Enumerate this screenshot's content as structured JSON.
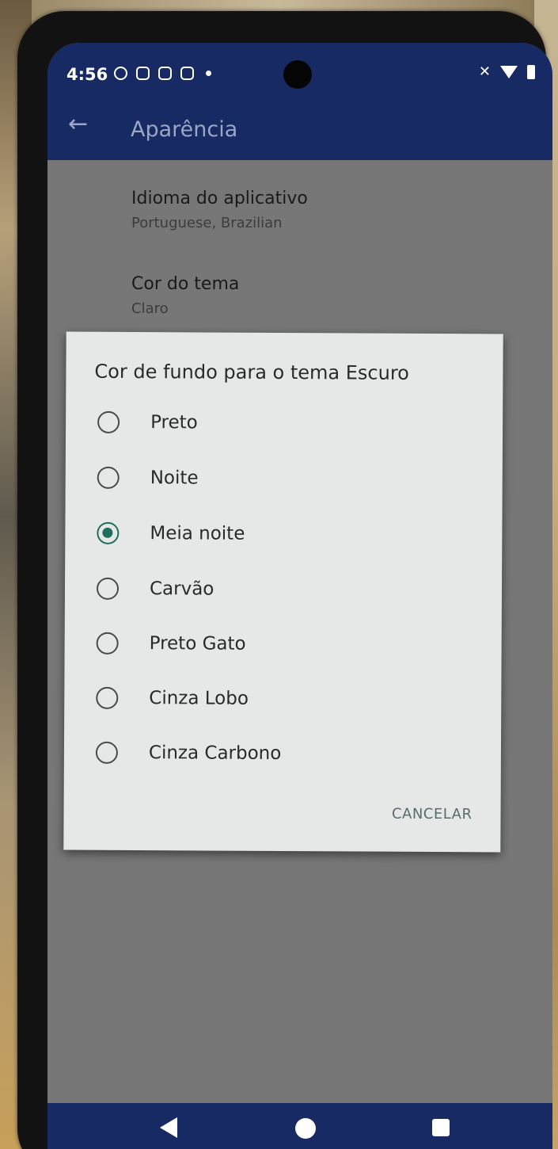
{
  "status_bar": {
    "time": "4:56"
  },
  "app_bar": {
    "title": "Aparência"
  },
  "settings": [
    {
      "title": "Idioma do aplicativo",
      "subtitle": "Portuguese, Brazilian"
    },
    {
      "title": "Cor do tema",
      "subtitle": "Claro"
    }
  ],
  "dialog": {
    "title": "Cor de fundo para o tema Escuro",
    "options": [
      {
        "label": "Preto",
        "checked": false
      },
      {
        "label": "Noite",
        "checked": false
      },
      {
        "label": "Meia noite",
        "checked": true
      },
      {
        "label": "Carvão",
        "checked": false
      },
      {
        "label": "Preto Gato",
        "checked": false
      },
      {
        "label": "Cinza Lobo",
        "checked": false
      },
      {
        "label": "Cinza Carbono",
        "checked": false
      }
    ],
    "cancel_label": "CANCELAR"
  },
  "colors": {
    "app_bar": "#172a63",
    "radio_accent": "#1f6f5c",
    "dialog_bg": "#e6e8e8"
  }
}
